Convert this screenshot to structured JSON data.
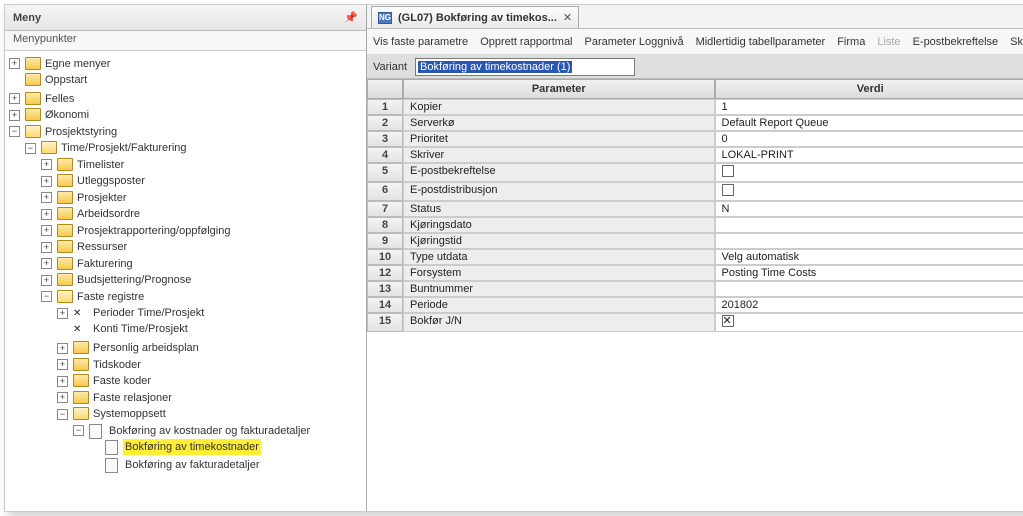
{
  "left": {
    "title": "Meny",
    "subtitle": "Menypunkter",
    "tree": {
      "egne": "Egne menyer",
      "oppstart": "Oppstart",
      "felles": "Felles",
      "okonomi": "Økonomi",
      "prosjektstyring": "Prosjektstyring",
      "time_fakt": "Time/Prosjekt/Fakturering",
      "timelister": "Timelister",
      "utleggsposter": "Utleggsposter",
      "prosjekter": "Prosjekter",
      "arbeidsordre": "Arbeidsordre",
      "prosjektrapport": "Prosjektrapportering/oppfølging",
      "ressurser": "Ressurser",
      "fakturering": "Fakturering",
      "budsjettering": "Budsjettering/Prognose",
      "faste_registre": "Faste registre",
      "perioder": "Perioder Time/Prosjekt",
      "konti": "Konti Time/Prosjekt",
      "personlig": "Personlig arbeidsplan",
      "tidskoder": "Tidskoder",
      "faste_koder": "Faste koder",
      "faste_relasjoner": "Faste relasjoner",
      "systemoppsett": "Systemoppsett",
      "bokf_kost_fakt": "Bokføring av kostnader og fakturadetaljer",
      "bokf_time": "Bokføring av timekostnader",
      "bokf_fakt": "Bokføring av fakturadetaljer"
    }
  },
  "tab": {
    "icon_text": "NG",
    "title": "(GL07) Bokføring av timekos..."
  },
  "toolbar": {
    "vis": "Vis faste parametre",
    "opprett": "Opprett rapportmal",
    "param_logg": "Parameter Loggnivå",
    "midl": "Midlertidig tabellparameter",
    "firma": "Firma",
    "liste": "Liste",
    "epost": "E-postbekreftelse",
    "skriver": "Skriverpar"
  },
  "variant": {
    "label": "Variant",
    "value": "Bokføring av timekostnader    (1)"
  },
  "grid": {
    "head_param": "Parameter",
    "head_verdi": "Verdi",
    "rows": [
      {
        "n": "1",
        "p": "Kopier",
        "v": "1"
      },
      {
        "n": "2",
        "p": "Serverkø",
        "v": "Default Report Queue"
      },
      {
        "n": "3",
        "p": "Prioritet",
        "v": "0"
      },
      {
        "n": "4",
        "p": "Skriver",
        "v": "LOKAL-PRINT"
      },
      {
        "n": "5",
        "p": "E-postbekreftelse",
        "v": "[unchecked]"
      },
      {
        "n": "6",
        "p": "E-postdistribusjon",
        "v": "[unchecked]"
      },
      {
        "n": "7",
        "p": "Status",
        "v": "N"
      },
      {
        "n": "8",
        "p": "Kjøringsdato",
        "v": ""
      },
      {
        "n": "9",
        "p": "Kjøringstid",
        "v": ""
      },
      {
        "n": "10",
        "p": "Type utdata",
        "v": "Velg automatisk"
      },
      {
        "n": "12",
        "p": "Forsystem",
        "v": "Posting Time Costs"
      },
      {
        "n": "13",
        "p": "Buntnummer",
        "v": ""
      },
      {
        "n": "14",
        "p": "Periode",
        "v": "201802"
      },
      {
        "n": "15",
        "p": "Bokfør J/N",
        "v": "[checked]"
      }
    ]
  }
}
